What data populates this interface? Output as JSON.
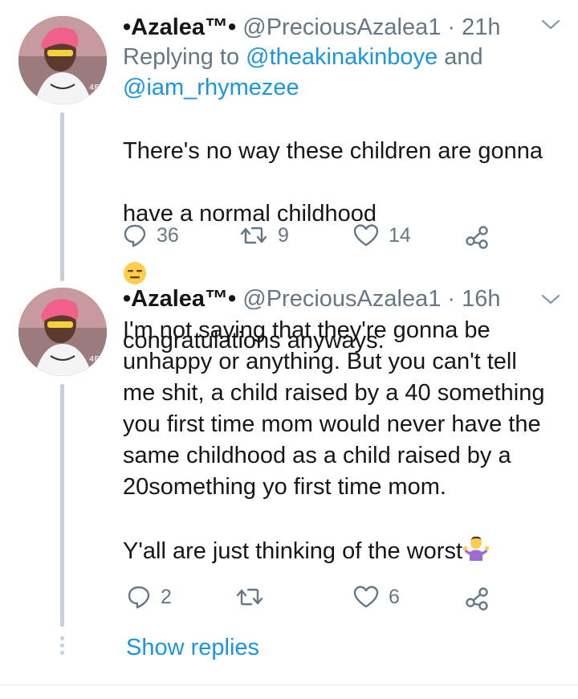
{
  "tweets": [
    {
      "name": "•Azalea™•",
      "handle": "@PreciousAzalea1",
      "time": "· 21h",
      "reply_prefix": "Replying to ",
      "reply_user1": "@theakinakinboye",
      "reply_and": " and",
      "reply_user2": "@iam_rhymezee",
      "line1": "There's no way these children are gonna",
      "line2": "have a normal childhood",
      "line3": "congratulations anyways.",
      "replies": "36",
      "retweets": "9",
      "likes": "14"
    },
    {
      "name": "•Azalea™•",
      "handle": "@PreciousAzalea1",
      "time": "· 16h",
      "text": "I'm not saying that they're gonna be\nunhappy or anything. But you can't tell\nme shit, a child raised by a 40 something\nyou first time mom would never have the\nsame childhood as a child raised by a\n20something yo first time mom.\n\nY'all are just thinking of the worst",
      "replies": "2",
      "retweets": "",
      "likes": "6"
    }
  ],
  "show_replies": "Show replies",
  "icons": [
    "reply-icon",
    "retweet-icon",
    "like-icon",
    "share-icon",
    "chevron-down-icon",
    "expressionless-emoji",
    "shrug-emoji"
  ],
  "colors": {
    "link": "#1b95e0",
    "secondary": "#657786",
    "thread_line": "#c4cfd6"
  }
}
